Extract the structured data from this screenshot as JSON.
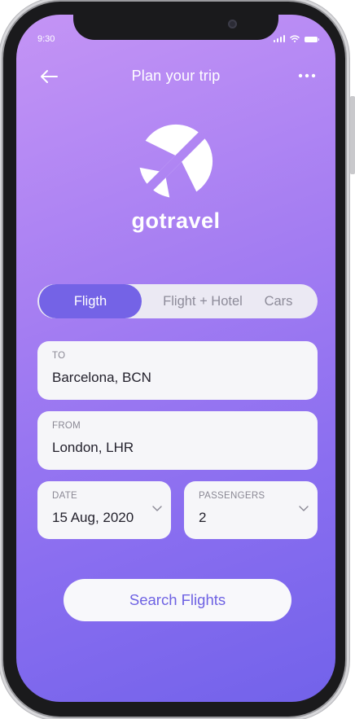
{
  "status_bar": {
    "time": "9:30"
  },
  "header": {
    "title": "Plan your trip",
    "back_icon": "arrow-left-icon",
    "more_icon": "ellipsis-icon"
  },
  "brand": {
    "name": "gotravel",
    "logo_icon": "airplane-circle-icon"
  },
  "tabs": [
    {
      "label": "Fligth",
      "active": true
    },
    {
      "label": "Flight + Hotel",
      "active": false
    },
    {
      "label": "Cars",
      "active": false
    }
  ],
  "form": {
    "to": {
      "label": "TO",
      "value": "Barcelona, BCN"
    },
    "from": {
      "label": "FROM",
      "value": "London, LHR"
    },
    "date": {
      "label": "DATE",
      "value": "15 Aug, 2020"
    },
    "passengers": {
      "label": "PASSENGERS",
      "value": "2"
    }
  },
  "search_button": {
    "label": "Search Flights"
  },
  "colors": {
    "gradient_start": "#c494f5",
    "gradient_end": "#7262ea",
    "accent": "#7463e6",
    "button_text": "#6e62e3"
  }
}
